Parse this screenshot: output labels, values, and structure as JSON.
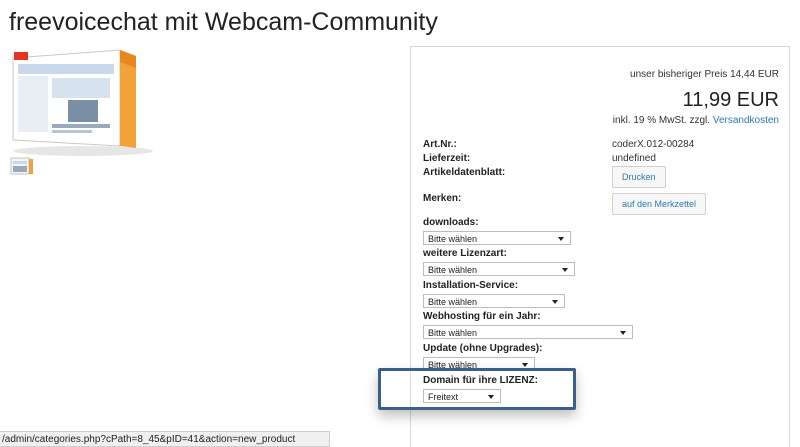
{
  "page": {
    "title": "freevoicechat mit Webcam-Community"
  },
  "price": {
    "old": "unser bisheriger Preis 14,44 EUR",
    "current": "11,99 EUR",
    "tax_prefix": "inkl. 19 % MwSt. zzgl.",
    "shipping_link": "Versandkosten"
  },
  "details": {
    "art_nr_label": "Art.Nr.:",
    "art_nr_value": "coderX.012-00284",
    "lieferzeit_label": "Lieferzeit:",
    "lieferzeit_value": "undefined",
    "datasheet_label": "Artikeldatenblatt:",
    "print_button": "Drucken",
    "merken_label": "Merken:",
    "wishlist_button": "auf den Merkzettel"
  },
  "options": [
    {
      "label": "downloads:",
      "value": "Bitte wählen"
    },
    {
      "label": "weitere Lizenzart:",
      "value": "Bitte wählen"
    },
    {
      "label": "Installation-Service:",
      "value": "Bitte wählen"
    },
    {
      "label": "Webhosting für ein Jahr:",
      "value": "Bitte wählen"
    },
    {
      "label": "Update (ohne Upgrades):",
      "value": "Bitte wählen"
    },
    {
      "label": "Domain für ihre LIZENZ:",
      "value": "Freitext"
    }
  ],
  "status_bar": {
    "url": "/admin/categories.php?cPath=8_45&pID=41&action=new_product"
  },
  "colors": {
    "link": "#2a7ab8",
    "highlight": "#3a5f8a"
  }
}
